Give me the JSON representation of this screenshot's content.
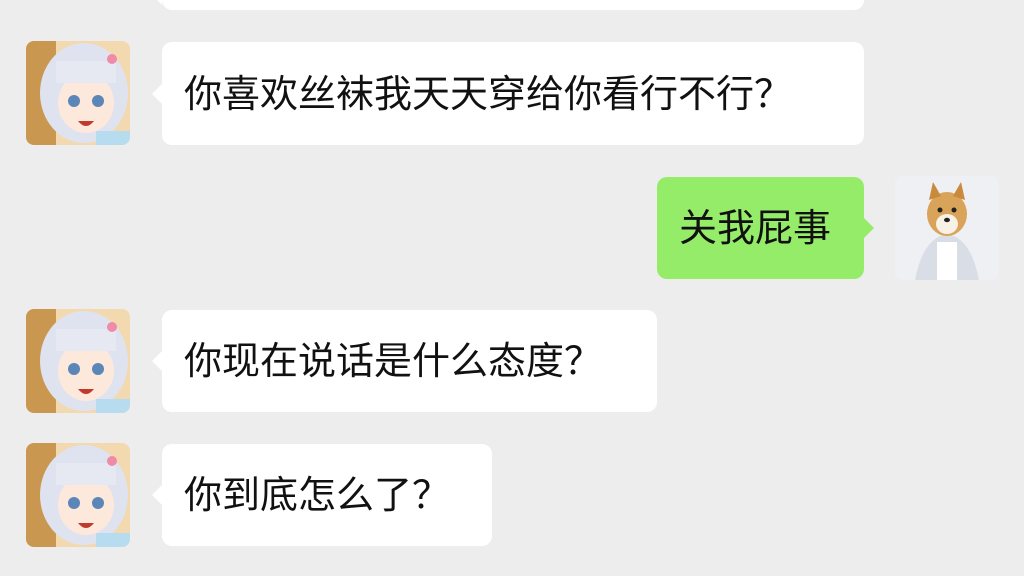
{
  "chat": {
    "messages": [
      {
        "sender": "other",
        "text": ""
      },
      {
        "sender": "other",
        "text": "你喜欢丝袜我天天穿给你看行不行？"
      },
      {
        "sender": "me",
        "text": "关我屁事"
      },
      {
        "sender": "other",
        "text": "你现在说话是什么态度？"
      },
      {
        "sender": "other",
        "text": "你到底怎么了？"
      }
    ]
  },
  "avatars": {
    "other": "anime-girl-avatar",
    "me": "shiba-dog-avatar"
  },
  "colors": {
    "background": "#ededed",
    "bubble_other": "#ffffff",
    "bubble_me": "#95ec69"
  }
}
